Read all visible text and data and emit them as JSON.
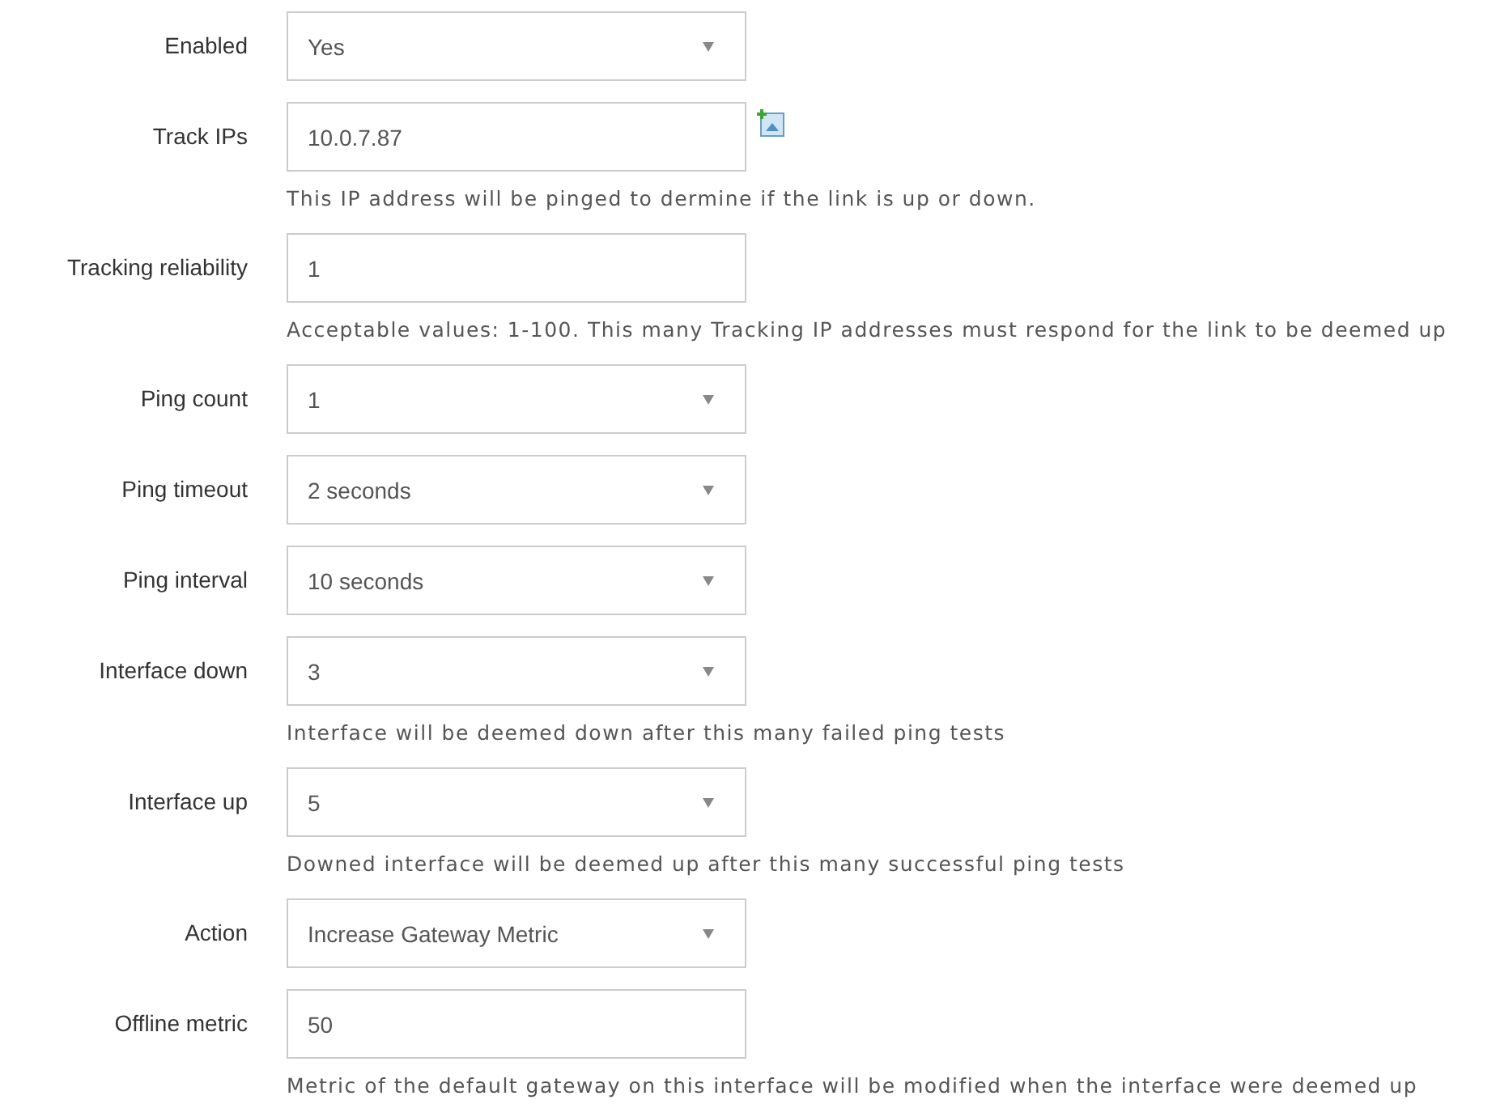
{
  "fields": [
    {
      "label": "Enabled",
      "kind": "select",
      "value": "Yes"
    },
    {
      "label": "Track IPs",
      "kind": "input",
      "value": "10.0.7.87",
      "add_button": true,
      "hint": "This IP address will be pinged to dermine if the link is up or down."
    },
    {
      "label": "Tracking reliability",
      "kind": "input",
      "value": "1",
      "hint": "Acceptable values: 1-100. This many Tracking IP addresses must respond for the link to be deemed up"
    },
    {
      "label": "Ping count",
      "kind": "select",
      "value": "1"
    },
    {
      "label": "Ping timeout",
      "kind": "select",
      "value": "2 seconds"
    },
    {
      "label": "Ping interval",
      "kind": "select",
      "value": "10 seconds"
    },
    {
      "label": "Interface down",
      "kind": "select",
      "value": "3",
      "hint": "Interface will be deemed down after this many failed ping tests"
    },
    {
      "label": "Interface up",
      "kind": "select",
      "value": "5",
      "hint": "Downed interface will be deemed up after this many successful ping tests"
    },
    {
      "label": "Action",
      "kind": "select",
      "value": "Increase Gateway Metric"
    },
    {
      "label": "Offline metric",
      "kind": "input",
      "value": "50",
      "hint": "Metric of the default gateway on this interface will be modified when the interface were deemed up"
    }
  ]
}
